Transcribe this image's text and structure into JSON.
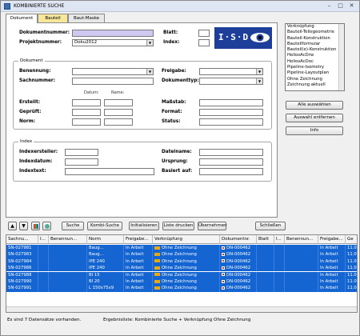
{
  "window": {
    "title": "KOMBINIERTE SUCHE",
    "minimize": "–",
    "maximize": "□",
    "close": "✕"
  },
  "tabs": [
    {
      "label": "Dokument"
    },
    {
      "label": "Bauteil"
    },
    {
      "label": "Baut-Maske"
    }
  ],
  "top": {
    "dokumentnummer_label": "Dokumentnummer:",
    "dokumentnummer_value": "",
    "projektnummer_label": "Projektnummer:",
    "projektnummer_value": "Doku2012",
    "blatt_label": "Blatt:",
    "blatt_value": "",
    "index_label": "Index:",
    "index_value": ""
  },
  "logo": {
    "text": "I·S·D"
  },
  "dokument_group": {
    "title": "Dokument",
    "benennung_label": "Benennung:",
    "sachnummer_label": "Sachnummer:",
    "freigabe_label": "Freigabe:",
    "dokumenttyp_label": "Dokumenttyp:",
    "datum_label": "Datum:",
    "name_label": "Name:",
    "erstellt_label": "Erstellt:",
    "geprueft_label": "Geprüft:",
    "norm_label": "Norm:",
    "massstab_label": "Maßstab:",
    "format_label": "Format:",
    "status_label": "Status:"
  },
  "index_group": {
    "title": "Index",
    "indexersteller_label": "Indexersteller:",
    "indexdatum_label": "Indexdatum:",
    "indextext_label": "Indextext:",
    "dateiname_label": "Dateiname:",
    "ursprung_label": "Ursprung:",
    "basiert_auf_label": "Basiert auf:"
  },
  "search_types": [
    "Verknüpfung",
    "Bauteil-Teilegeometrie",
    "Bauteil-Konstruktion",
    "Bauteilformular",
    "Bauteil(e)-Konstruktion",
    "HeliosAcDrw",
    "HeliosAcDoc",
    "Pipeline-Isometry",
    "Pipeline-Layoutplan",
    "Ohne Zeichnung",
    "Zeichnung aktuell"
  ],
  "right_buttons": {
    "select_all": "Alle auswählen",
    "deselect": "Auswahl entfernen",
    "info": "Info"
  },
  "toolbar": {
    "suche": "Suche",
    "kombi_suche": "Kombi-Suche",
    "initialisieren": "Initialisieren",
    "liste_drucken": "Liste drucken",
    "uebernehmen": "Übernehmen",
    "schliessen": "Schließen"
  },
  "grid": {
    "columns": [
      "Sachnu...",
      "I...",
      "Benennun...",
      "Norm",
      "Freigabe...",
      "Verknüpfung",
      "Dokumentnr.",
      "Blatt",
      "I...",
      "Benennun...",
      "Freigabe...",
      "Ge"
    ],
    "rows": [
      {
        "sachnr": "SN-027981",
        "benennung": "",
        "norm": "Baug...",
        "freigabe": "In Arbeit",
        "verknuepfung": "Ohne Zeichnung",
        "dokumentnr": "DN-000462",
        "freigabe2": "In Arbeit",
        "ge": "11.0"
      },
      {
        "sachnr": "SN-027983",
        "benennung": "",
        "norm": "Baug...",
        "freigabe": "In Arbeit",
        "verknuepfung": "Ohne Zeichnung",
        "dokumentnr": "DN-000462",
        "freigabe2": "In Arbeit",
        "ge": "11.0"
      },
      {
        "sachnr": "SN-027984",
        "benennung": "",
        "norm": "IPE 240",
        "freigabe": "In Arbeit",
        "verknuepfung": "Ohne Zeichnung",
        "dokumentnr": "DN-000462",
        "freigabe2": "In Arbeit",
        "ge": "11.0"
      },
      {
        "sachnr": "SN-027986",
        "benennung": "",
        "norm": "IPE 240",
        "freigabe": "In Arbeit",
        "verknuepfung": "Ohne Zeichnung",
        "dokumentnr": "DN-000462",
        "freigabe2": "In Arbeit",
        "ge": "11.0"
      },
      {
        "sachnr": "SN-027988",
        "benennung": "",
        "norm": "BI 15",
        "freigabe": "In Arbeit",
        "verknuepfung": "Ohne Zeichnung",
        "dokumentnr": "DN-000462",
        "freigabe2": "In Arbeit",
        "ge": "11.0"
      },
      {
        "sachnr": "SN-027990",
        "benennung": "",
        "norm": "BI 20",
        "freigabe": "In Arbeit",
        "verknuepfung": "Ohne Zeichnung",
        "dokumentnr": "DN-000462",
        "freigabe2": "In Arbeit",
        "ge": "11.0"
      },
      {
        "sachnr": "SN-027991",
        "benennung": "",
        "norm": "L 150x75x9",
        "freigabe": "In Arbeit",
        "verknuepfung": "Ohne Zeichnung",
        "dokumentnr": "DN-000462",
        "freigabe2": "In Arbeit",
        "ge": "11.0"
      }
    ]
  },
  "status": {
    "count_text": "Es sind 7 Datensätze vorhanden.",
    "result_text": "Ergebnisliste: Kombinierte Suche + Verknüpfung Ohne Zeichnung"
  },
  "colors": {
    "selection": "#1464d2",
    "highlight_field": "#cfc8f2",
    "logo_bg": "#1e3f99",
    "tab_yellow": "#f6e79a"
  }
}
